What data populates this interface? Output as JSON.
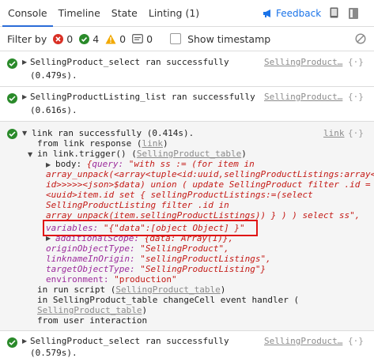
{
  "tabs": [
    "Console",
    "Timeline",
    "State",
    "Linting (1)"
  ],
  "feedback_label": "Feedback",
  "filter": {
    "label": "Filter by",
    "errors": "0",
    "success": "4",
    "warnings": "0",
    "info": "0",
    "timestamp_label": "Show timestamp"
  },
  "entries": {
    "e1": {
      "line1": "SellingProduct_select ran successfully",
      "line2": "(0.479s).",
      "source": "SellingProduct…",
      "brace": "{·}"
    },
    "e2": {
      "line1": "SellingProductListing_list ran successfully",
      "line2": "(0.616s).",
      "source": "SellingProduct…",
      "brace": "{·}"
    },
    "e3": {
      "head": "link ran successfully (0.414s).",
      "source": "link",
      "brace": "{·}",
      "from_prefix": "from link response (",
      "from_link": "link",
      "from_suffix": ")",
      "trigger_prefix": "in link.trigger() (",
      "trigger_link": "SellingProduct_table",
      "trigger_suffix": ")",
      "body_key": "body:",
      "body_open": "{",
      "query_key": "query:",
      "query_lines": [
        "\"with ss := (for item in",
        "array_unpack(<array<tuple<id:uuid,sellingProductListings:array<uu",
        "id>>>>><json>$data) union ( update SellingProduct filter .id =",
        "<uuid>item.id set { sellingProductListings:=(select",
        "SellingProductListing filter .id in",
        "array_unpack(item.sellingProductListings)) } ) ) select ss\","
      ],
      "variables_key": "variables:",
      "variables_val": "\"{\"data\":[object Object] }\"",
      "additional_key": "additionalScope:",
      "additional_val": "{data: Array(1)},",
      "origin_key": "originObjectType:",
      "origin_val": "\"SellingProduct\",",
      "linkname_key": "linknameInOrigin:",
      "linkname_val": "\"sellingProductListings\",",
      "target_key": "targetObjectType:",
      "target_val": "\"SellingProductListing\"}",
      "env_key": "environment:",
      "env_val": "\"production\"",
      "run_prefix": "in run script (",
      "run_link": "SellingProduct_table",
      "run_suffix": ")",
      "cell_line": "in SellingProduct_table changeCell event handler (",
      "cell_link": "SellingProduct_table",
      "cell_suffix": ")",
      "user_line": "from user interaction"
    },
    "e4": {
      "line1": "SellingProduct_select ran successfully",
      "line2": "(0.579s).",
      "source": "SellingProduct…",
      "brace": "{·}"
    }
  },
  "colors": {
    "accent": "#2b6cd8",
    "success": "#2a8a2a",
    "error": "#d93025",
    "warning": "#f2a900",
    "highlight": "#e01515"
  },
  "icons": [
    "megaphone-icon",
    "book-icon",
    "settings-icon",
    "error-icon",
    "success-icon",
    "warning-icon",
    "info-icon",
    "clear-icon",
    "check-icon",
    "expand-icon"
  ]
}
